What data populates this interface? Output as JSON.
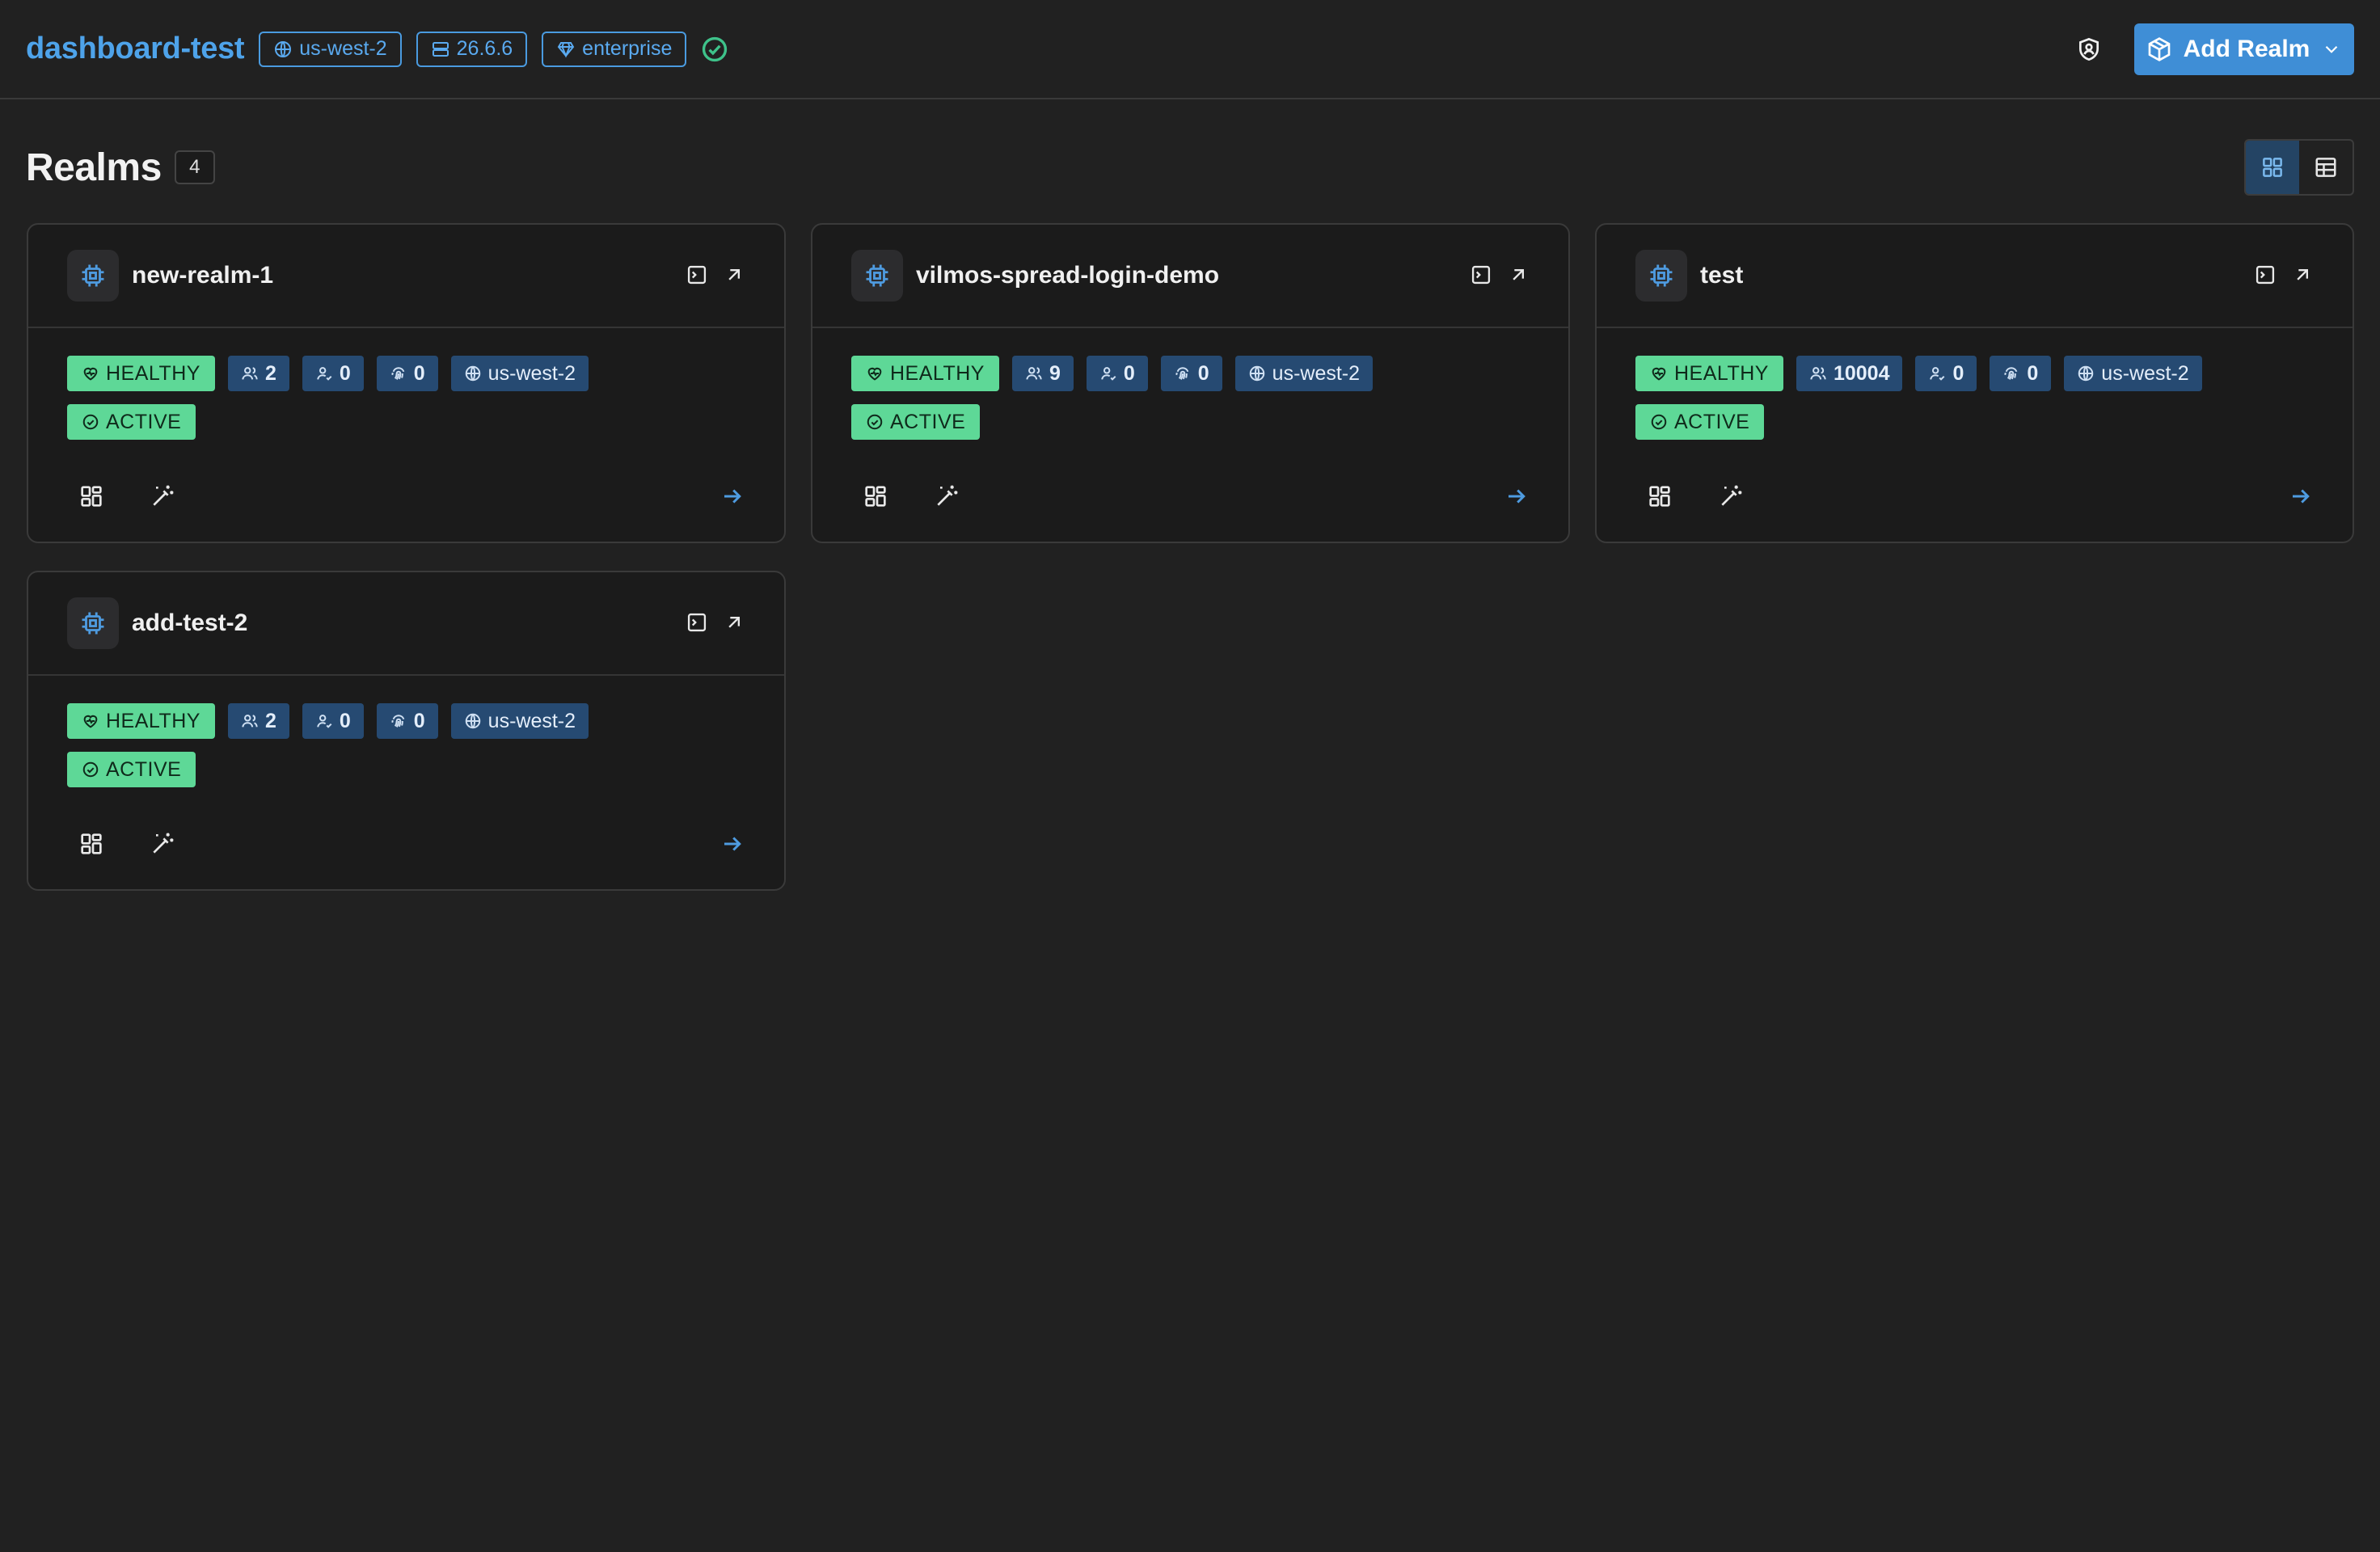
{
  "header": {
    "title": "dashboard-test",
    "chips": [
      {
        "label": "us-west-2",
        "icon": "globe-icon"
      },
      {
        "label": "26.6.6",
        "icon": "server-icon"
      },
      {
        "label": "enterprise",
        "icon": "diamond-icon"
      }
    ],
    "status_icon": "check-circle-icon",
    "add_button": {
      "label": "Add Realm",
      "icon": "package-icon",
      "menu_icon": "chevron-down-icon"
    }
  },
  "section": {
    "title": "Realms",
    "count": "4",
    "views": [
      {
        "name": "grid",
        "icon": "grid-icon",
        "active": true
      },
      {
        "name": "table",
        "icon": "table-icon",
        "active": false
      }
    ]
  },
  "realms": [
    {
      "name": "new-realm-1",
      "health": "HEALTHY",
      "users": "2",
      "sessions": "0",
      "clients": "0",
      "region": "us-west-2",
      "status": "ACTIVE"
    },
    {
      "name": "vilmos-spread-login-demo",
      "health": "HEALTHY",
      "users": "9",
      "sessions": "0",
      "clients": "0",
      "region": "us-west-2",
      "status": "ACTIVE"
    },
    {
      "name": "test",
      "health": "HEALTHY",
      "users": "10004",
      "sessions": "0",
      "clients": "0",
      "region": "us-west-2",
      "status": "ACTIVE"
    },
    {
      "name": "add-test-2",
      "health": "HEALTHY",
      "users": "2",
      "sessions": "0",
      "clients": "0",
      "region": "us-west-2",
      "status": "ACTIVE"
    }
  ],
  "colors": {
    "background": "#212121",
    "accent": "#3f8ed6",
    "title_blue": "#4ea3ea",
    "healthy_green": "#5ed897",
    "tag_blue": "#264a72"
  }
}
